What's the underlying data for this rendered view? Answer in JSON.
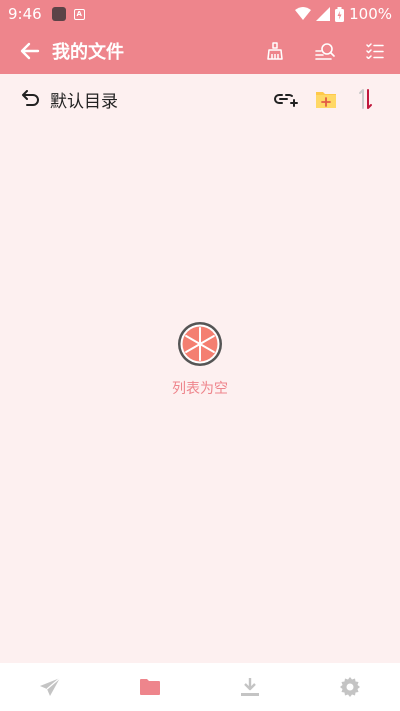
{
  "status": {
    "time": "9:46",
    "app_icon_letter": "A",
    "battery": "100%"
  },
  "appbar": {
    "title": "我的文件"
  },
  "path": {
    "current_dir": "默认目录"
  },
  "empty": {
    "message": "列表为空"
  },
  "colors": {
    "accent": "#ee858c",
    "background": "#fdf0f0",
    "grapefruit": "#f47f71"
  },
  "bottom_nav": {
    "tabs": [
      "send-icon",
      "folder-icon",
      "download-icon",
      "settings-icon"
    ],
    "active": "folder-icon"
  }
}
